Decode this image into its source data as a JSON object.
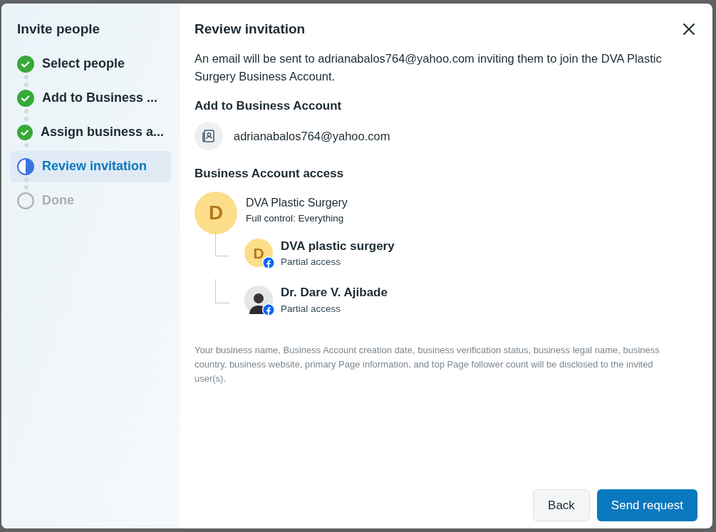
{
  "sidebar": {
    "title": "Invite people",
    "steps": [
      {
        "label": "Select people",
        "kind": "done",
        "selected": false
      },
      {
        "label": "Add to Business ...",
        "kind": "done",
        "selected": false
      },
      {
        "label": "Assign business a...",
        "kind": "done",
        "selected": false
      },
      {
        "label": "Review invitation",
        "kind": "current",
        "selected": true
      },
      {
        "label": "Done",
        "kind": "pending",
        "selected": false
      }
    ]
  },
  "main": {
    "title": "Review invitation",
    "intro": "An email will be sent to adrianabalos764@yahoo.com inviting them to join the DVA Plastic Surgery Business Account.",
    "add_heading": "Add to Business Account",
    "email": "adrianabalos764@yahoo.com",
    "access_heading": "Business Account access",
    "account": {
      "avatar_letter": "D",
      "name": "DVA Plastic Surgery",
      "access": "Full control: Everything"
    },
    "assets": [
      {
        "kind": "letter",
        "avatar_letter": "D",
        "badge": true,
        "name": "DVA plastic surgery",
        "access": "Partial access"
      },
      {
        "kind": "photo",
        "badge": true,
        "name": "Dr. Dare V. Ajibade",
        "access": "Partial access"
      }
    ],
    "disclaimer": "Your business name, Business Account creation date, business verification status, business legal name, business country, business website, primary Page information, and top Page follower count will be disclosed to the invited user(s).",
    "buttons": [
      {
        "label": "Back",
        "kind": "secondary"
      },
      {
        "label": "Send request",
        "kind": "primary"
      }
    ]
  }
}
